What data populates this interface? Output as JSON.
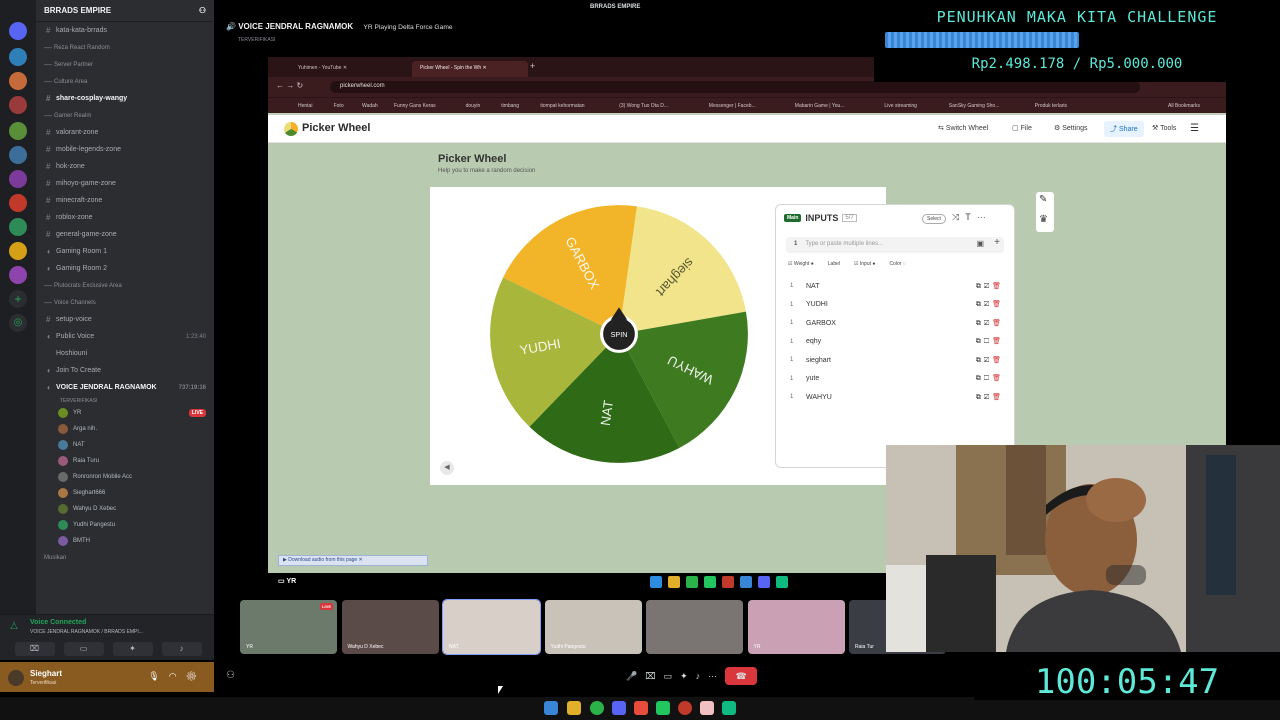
{
  "discord": {
    "server_name": "BRRADS EMPIRE",
    "top_channel_cut": "kata-kata-brrads",
    "channels": [
      {
        "kind": "cat",
        "label": "Reza React Random"
      },
      {
        "kind": "cat",
        "label": "Server Partner"
      },
      {
        "kind": "cat",
        "label": "Culture Area"
      },
      {
        "kind": "text",
        "label": "share-cosplay-wangy",
        "bold": true
      },
      {
        "kind": "cat",
        "label": "Gamer Realm"
      },
      {
        "kind": "text",
        "label": "valorant-zone"
      },
      {
        "kind": "text",
        "label": "mobile-legends-zone"
      },
      {
        "kind": "text",
        "label": "hok-zone"
      },
      {
        "kind": "text",
        "label": "mihoyo-game-zone"
      },
      {
        "kind": "text",
        "label": "minecraft-zone"
      },
      {
        "kind": "text",
        "label": "roblox-zone"
      },
      {
        "kind": "text",
        "label": "general-game-zone"
      },
      {
        "kind": "voice",
        "label": "Gaming Room 1"
      },
      {
        "kind": "voice",
        "label": "Gaming Room 2"
      },
      {
        "kind": "cat",
        "label": "Plutocrats Exclusive Area"
      },
      {
        "kind": "cat",
        "label": "Voice Channels"
      },
      {
        "kind": "text",
        "label": "setup-voice"
      },
      {
        "kind": "voice",
        "label": "Public Voice",
        "right": "1:23:40"
      },
      {
        "kind": "sub",
        "label": "Hoshiouni"
      },
      {
        "kind": "voice",
        "label": "Join To Create"
      }
    ],
    "active_voice": {
      "label": "VOICE JENDRAL RAGNAMOK",
      "time": "737:19:16",
      "sub": "TERVERIFIKASI"
    },
    "voice_users": [
      {
        "name": "YR",
        "live": "LIVE"
      },
      {
        "name": "Arga nih."
      },
      {
        "name": "NAT"
      },
      {
        "name": "Raia Turu"
      },
      {
        "name": "Ronronron Mobile Acc"
      },
      {
        "name": "Sieghart666"
      },
      {
        "name": "Wahyu D Xebec"
      },
      {
        "name": "Yudhi Pangestu"
      },
      {
        "name": "BMTH"
      }
    ],
    "bottom_cat": "Musikan",
    "voice_connected": "Voice Connected",
    "voice_connected_sub": "VOICE JENDRAL RAGNAMOK / BRRADS EMPI...",
    "user": {
      "name": "Sieghart",
      "status": "Terverifikasi"
    }
  },
  "stream": {
    "channel": "VOICE JENDRAL RAGNAMOK",
    "activity": "YR Playing Delta Force Game",
    "verified": "TERVERIFIKASI",
    "top_server": "BRRADS EMPIRE",
    "share_label": "YR",
    "tiles": [
      {
        "name": "YR",
        "live": "LIVE"
      },
      {
        "name": "Wahyu D Xebec"
      },
      {
        "name": "NAT"
      },
      {
        "name": "Yudhi Pangestu"
      },
      {
        "name": ""
      },
      {
        "name": "YR"
      },
      {
        "name": "Raia Tur"
      }
    ]
  },
  "browser": {
    "tabs": [
      "Yuhimen - YouTube",
      "Picker Wheel - Spin the Wh"
    ],
    "url": "pickerwheel.com",
    "bookmarks": [
      "Hentai",
      "Foto",
      "Wadah",
      "Funny Gans Keras",
      "douyin",
      "timbang",
      "tiompat kehormatan",
      "(3) Wong Tuo Ota D...",
      "Messenger | Faceb...",
      "Mabarin Game | You...",
      "Live streaming",
      "SanSky Gaming Sho...",
      "Produk terlaris",
      "All Bookmarks"
    ]
  },
  "picker": {
    "brand": "Picker Wheel",
    "menu": [
      "Switch Wheel",
      "File",
      "Settings",
      "Share",
      "Tools"
    ],
    "title": "Picker Wheel",
    "subtitle": "Help you to make a random decision",
    "spin": "SPIN",
    "inputs_title": "INPUTS",
    "inputs_badge": "Main",
    "inputs_count": "5/7",
    "select": "Select",
    "placeholder": "Type or paste multiple lines...",
    "cols": [
      "Weight",
      "Label",
      "Input",
      "Color"
    ],
    "entries": [
      {
        "w": "1",
        "label": "NAT",
        "checked": true
      },
      {
        "w": "1",
        "label": "YUDHI",
        "checked": true
      },
      {
        "w": "1",
        "label": "GARBOX",
        "checked": true
      },
      {
        "w": "1",
        "label": "eqhy",
        "checked": false
      },
      {
        "w": "1",
        "label": "sieghart",
        "checked": true
      },
      {
        "w": "1",
        "label": "yute",
        "checked": false
      },
      {
        "w": "1",
        "label": "WAHYU",
        "checked": true
      }
    ],
    "wheel_segments": [
      {
        "label": "sieghart",
        "color": "#f1e48a"
      },
      {
        "label": "WAHYU",
        "color": "#3e7a1f"
      },
      {
        "label": "NAT",
        "color": "#2f6a17"
      },
      {
        "label": "YUDHI",
        "color": "#a8b63c"
      },
      {
        "label": "GARBOX",
        "color": "#f2b428"
      }
    ],
    "download_bar": "Download audio from this page"
  },
  "overlay": {
    "challenge_title": "PENUHKAN MAKA KITA CHALLENGE",
    "progress_fraction": 0.4996,
    "amount": "Rp2.498.178 / Rp5.000.000",
    "timer": "100:05:47"
  }
}
